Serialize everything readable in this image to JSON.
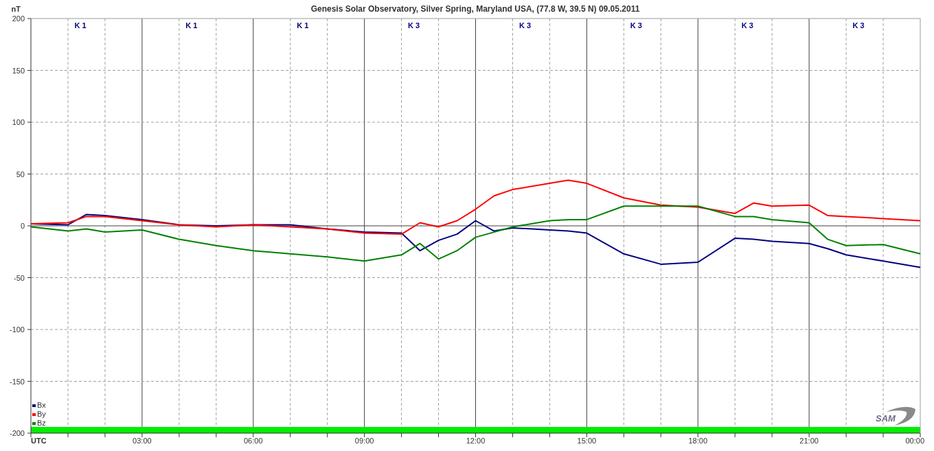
{
  "chart": {
    "title": "Genesis Solar Observatory, Silver Spring, Maryland USA, (77.8 W, 39.5 N)  09.05.2011",
    "k_indices": [
      {
        "label": "K 1"
      },
      {
        "label": "K 1"
      },
      {
        "label": "K 1"
      },
      {
        "label": "K 3"
      },
      {
        "label": "K 3"
      },
      {
        "label": "K 3"
      },
      {
        "label": "K 3"
      },
      {
        "label": "K 3"
      }
    ],
    "logo": {
      "text": "SAM"
    },
    "chart_data": {
      "type": "line",
      "grid": true,
      "legend": true,
      "ylabel": "nT",
      "x": [
        0,
        1,
        1.5,
        2,
        3,
        4,
        5,
        6,
        7,
        8,
        9,
        10,
        10.5,
        11,
        11.5,
        12,
        12.5,
        13,
        14,
        14.5,
        15,
        16,
        17,
        18,
        19,
        19.5,
        20,
        21,
        21.5,
        22,
        23,
        24
      ],
      "series": [
        {
          "name": "Bx",
          "color": "#000080",
          "values": [
            2,
            1,
            11,
            10,
            6,
            1,
            0,
            1,
            1,
            -3,
            -6,
            -7,
            -24,
            -14,
            -8,
            5,
            -5,
            -2,
            -4,
            -5,
            -7,
            -27,
            -37,
            -35,
            -12,
            -13,
            -15,
            -17,
            -22,
            -28,
            -34,
            -40
          ]
        },
        {
          "name": "By",
          "color": "#ff0000",
          "values": [
            2,
            3,
            9,
            9,
            5,
            1,
            -1,
            1,
            -1,
            -3,
            -7,
            -8,
            3,
            -1,
            5,
            16,
            29,
            35,
            41,
            44,
            41,
            27,
            20,
            18,
            12,
            22,
            19,
            20,
            10,
            9,
            7,
            5
          ]
        },
        {
          "name": "Bz",
          "color": "#008000",
          "values": [
            -1,
            -5,
            -3,
            -6,
            -4,
            -13,
            -19,
            -24,
            -27,
            -30,
            -34,
            -28,
            -17,
            -32,
            -24,
            -11,
            -6,
            -1,
            5,
            6,
            6,
            19,
            19,
            19,
            9,
            9,
            6,
            3,
            -13,
            -19,
            -18,
            -27
          ]
        }
      ],
      "xlim": [
        0,
        24
      ],
      "ylim": [
        -200,
        200
      ],
      "xticks": [
        {
          "value": 0,
          "label": "UTC"
        },
        {
          "value": 3,
          "label": "03:00"
        },
        {
          "value": 6,
          "label": "06:00"
        },
        {
          "value": 9,
          "label": "09:00"
        },
        {
          "value": 12,
          "label": "12:00"
        },
        {
          "value": 15,
          "label": "15:00"
        },
        {
          "value": 18,
          "label": "18:00"
        },
        {
          "value": 21,
          "label": "21:00"
        },
        {
          "value": 24,
          "label": "00:00"
        }
      ],
      "yticks": [
        -200,
        -150,
        -100,
        -50,
        0,
        50,
        100,
        150,
        200
      ]
    }
  }
}
